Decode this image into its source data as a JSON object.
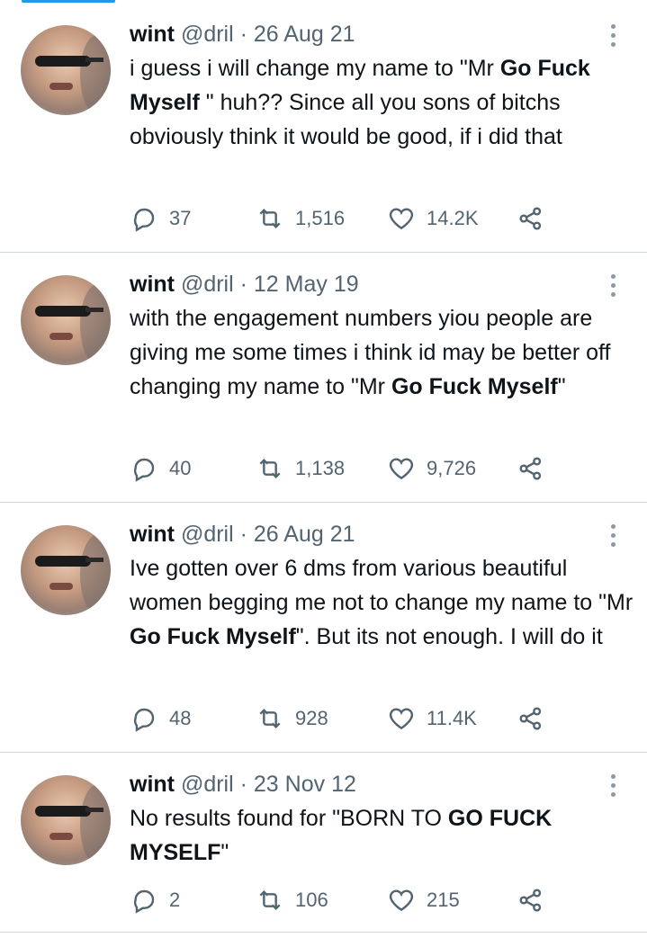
{
  "tweets": [
    {
      "name": "wint",
      "handle": "@dril",
      "sep": "·",
      "date": "26 Aug 21",
      "text_parts": [
        "i guess i will change my name to \"Mr ",
        "Go Fuck Myself",
        " \" huh?? Since all you sons of bitchs obviously think it would be good, if i did that"
      ],
      "replies": "37",
      "retweets": "1,516",
      "likes": "14.2K"
    },
    {
      "name": "wint",
      "handle": "@dril",
      "sep": "·",
      "date": "12 May 19",
      "text_parts": [
        "with the engagement numbers yiou people are giving me some times i think id may be better off changing my name to \"Mr ",
        "Go Fuck Myself",
        "\""
      ],
      "replies": "40",
      "retweets": "1,138",
      "likes": "9,726"
    },
    {
      "name": "wint",
      "handle": "@dril",
      "sep": "·",
      "date": "26 Aug 21",
      "text_parts": [
        "Ive gotten over 6 dms from various beautiful women begging me not to change my name to \"Mr ",
        "Go Fuck Myself",
        "\". But its not enough. I will do it"
      ],
      "replies": "48",
      "retweets": "928",
      "likes": "11.4K"
    },
    {
      "name": "wint",
      "handle": "@dril",
      "sep": "·",
      "date": "23 Nov 12",
      "text_parts": [
        "No results found for \"BORN TO ",
        "GO FUCK MYSELF",
        "\""
      ],
      "replies": "2",
      "retweets": "106",
      "likes": "215"
    }
  ],
  "icons": {
    "avatar": "avatar-image",
    "reply": "reply-icon",
    "retweet": "retweet-icon",
    "like": "like-icon",
    "share": "share-icon",
    "more": "more-options-icon"
  },
  "colors": {
    "accent": "#1d9bf0",
    "muted": "#536471",
    "text": "#0f1419"
  }
}
